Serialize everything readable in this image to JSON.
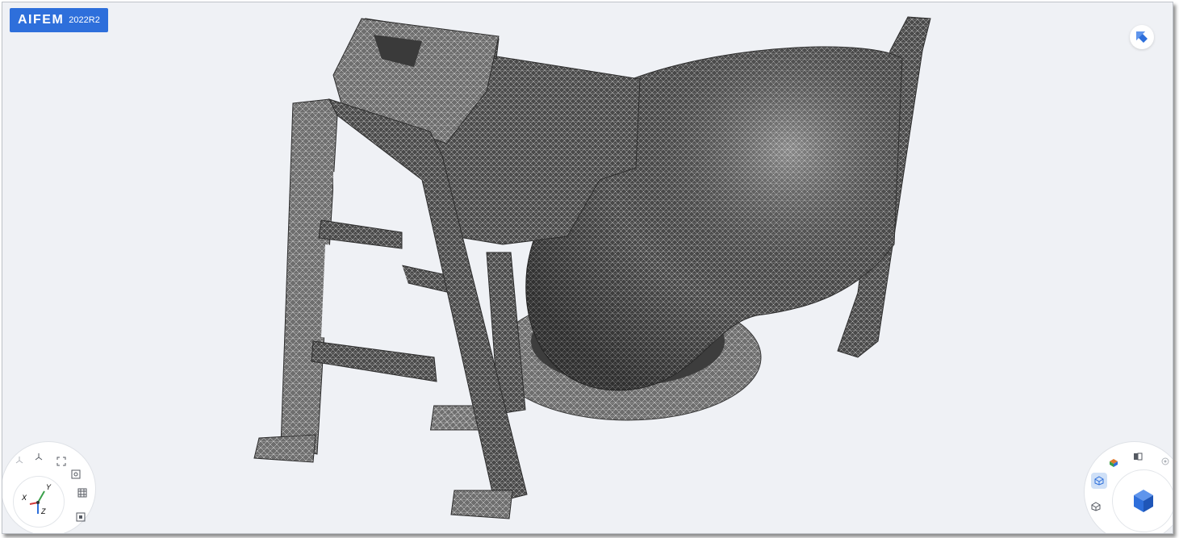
{
  "app": {
    "brand_name": "AIFEM",
    "brand_version": "2022R2"
  },
  "triad": {
    "x_label": "X",
    "y_label": "Y",
    "z_label": "Z"
  },
  "colors": {
    "accent": "#2e6fdb",
    "mesh_dark": "#3d3d3d",
    "mesh_mid": "#5a5a5a",
    "mesh_light": "#8a8a8a",
    "viewport_bg": "#eff1f5"
  },
  "icons": {
    "left_wheel": [
      "axis-toggle-icon",
      "triad-icon",
      "fit-view-icon",
      "zoom-box-icon",
      "mesh-grid-icon",
      "zoom-selection-icon"
    ],
    "right_wheel": [
      "colored-cube-icon",
      "section-view-icon",
      "settings-icon",
      "mesh-cube-icon",
      "wireframe-cube-icon",
      "view-cube-icon"
    ],
    "orientation": "orientation-arrow-icon"
  }
}
